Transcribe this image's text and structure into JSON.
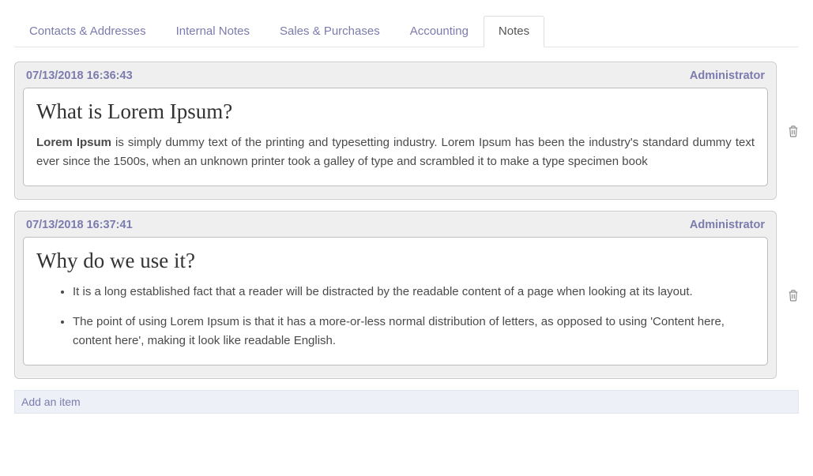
{
  "tabs": [
    {
      "label": "Contacts & Addresses",
      "active": false
    },
    {
      "label": "Internal Notes",
      "active": false
    },
    {
      "label": "Sales & Purchases",
      "active": false
    },
    {
      "label": "Accounting",
      "active": false
    },
    {
      "label": "Notes",
      "active": true
    }
  ],
  "notes": [
    {
      "timestamp": "07/13/2018 16:36:43",
      "author": "Administrator",
      "title": "What is Lorem Ipsum?",
      "body_html": "<strong>Lorem Ipsum</strong> is simply dummy text of the printing and typesetting industry. Lorem Ipsum has been the industry's standard dummy text ever since the 1500s, when an unknown printer took a galley of type and scrambled it to make a type specimen book"
    },
    {
      "timestamp": "07/13/2018 16:37:41",
      "author": "Administrator",
      "title": "Why do we use it?",
      "list": [
        "It is a long established fact that a reader will be distracted by the readable content of a page when looking at its layout.",
        "The point of using Lorem Ipsum is that it has a more-or-less normal distribution of letters, as opposed to using 'Content here, content here', making it look like readable English."
      ]
    }
  ],
  "add_item_label": "Add an item"
}
